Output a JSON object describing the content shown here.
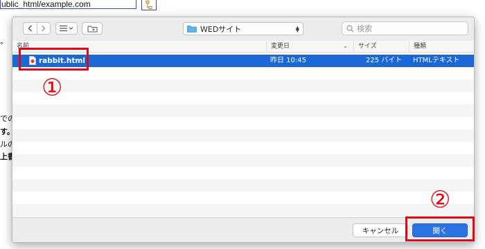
{
  "background": {
    "url_text": "ublic_html/example.com",
    "fragments": [
      "°",
      "での",
      "す。",
      "ルの",
      "上書"
    ]
  },
  "toolbar": {
    "back_icon": "chevron-left-icon",
    "forward_icon": "chevron-right-icon",
    "view_icon": "list-view-icon",
    "new_folder_icon": "new-folder-icon",
    "location": "WEDサイト",
    "search_placeholder": "検索"
  },
  "columns": {
    "name": "名前",
    "modified": "変更日",
    "size": "サイズ",
    "kind": "種類"
  },
  "files": [
    {
      "name": "rabbit.html",
      "modified": "昨日 10:45",
      "size": "225 バイト",
      "kind": "HTMLテキスト",
      "selected": true
    }
  ],
  "buttons": {
    "cancel": "キャンセル",
    "open": "開く"
  },
  "annotations": {
    "step1": "①",
    "step2": "②",
    "color": "#e30613"
  },
  "colors": {
    "selection": "#1a67d6",
    "primary_button": "#2a73e0"
  }
}
